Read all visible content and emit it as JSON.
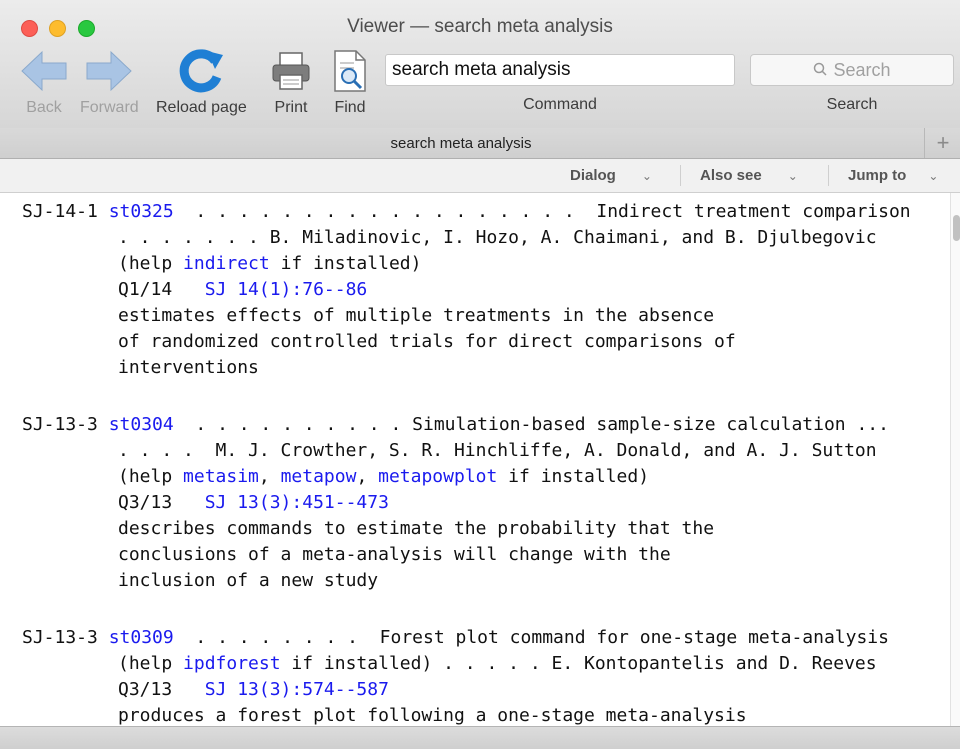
{
  "window": {
    "title": "Viewer — search meta analysis"
  },
  "toolbar": {
    "back_label": "Back",
    "forward_label": "Forward",
    "reload_label": "Reload page",
    "print_label": "Print",
    "find_label": "Find",
    "command_value": "search meta analysis",
    "command_label": "Command",
    "search_placeholder": "Search",
    "search_label": "Search"
  },
  "tabs": {
    "active": "search meta analysis",
    "new_tab": "+"
  },
  "subbar": {
    "dialog": "Dialog",
    "also_see": "Also see",
    "jump_to": "Jump to"
  },
  "results": {
    "r1": {
      "id": "SJ-14-1",
      "code": "st0325",
      "dots1": "  . . . . . . . . . . . . . . . . . .  ",
      "title": "Indirect treatment comparison",
      "authors_line": ". . . . . . . B. Miladinovic, I. Hozo, A. Chaimani, and B. Djulbegovic",
      "help_pre": "(help ",
      "help_links": [
        "indirect"
      ],
      "help_post": " if installed)",
      "issue": "Q1/14",
      "ref": "SJ 14(1):76--86",
      "desc": [
        "estimates effects of multiple treatments in the absence",
        "of randomized controlled trials for direct comparisons of",
        "interventions"
      ]
    },
    "r2": {
      "id": "SJ-13-3",
      "code": "st0304",
      "dots1": "  . . . . . . . . . . ",
      "title": "Simulation-based sample-size calculation ...",
      "authors_line": ". . . .  M. J. Crowther, S. R. Hinchliffe, A. Donald, and A. J. Sutton",
      "help_pre": "(help ",
      "help_links": [
        "metasim",
        "metapow",
        "metapowplot"
      ],
      "sep": ", ",
      "help_post": " if installed)",
      "issue": "Q3/13",
      "ref": "SJ 13(3):451--473",
      "desc": [
        "describes commands to estimate the probability that the",
        "conclusions of a meta-analysis will change with the",
        "inclusion of a new study"
      ]
    },
    "r3": {
      "id": "SJ-13-3",
      "code": "st0309",
      "dots1": "  . . . . . . . .  ",
      "title": "Forest plot command for one-stage meta-analysis",
      "help_pre": "(help ",
      "help_links": [
        "ipdforest"
      ],
      "help_post": " if installed) . . . . . E. Kontopantelis and D. Reeves",
      "issue": "Q3/13",
      "ref": "SJ 13(3):574--587",
      "desc": [
        "produces a forest plot following a one-stage meta-analysis"
      ]
    }
  },
  "colors": {
    "link": "#1a1aee",
    "text": "#111111"
  }
}
